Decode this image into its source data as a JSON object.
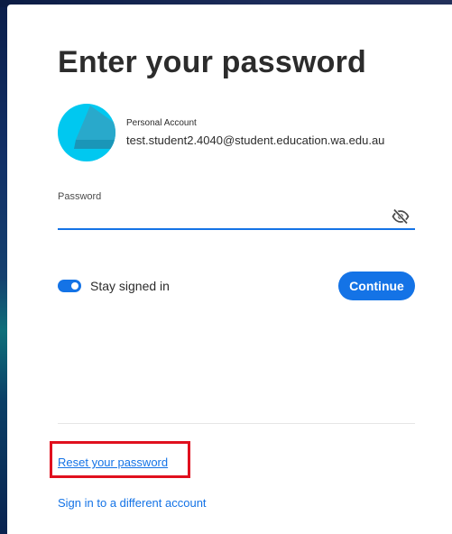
{
  "title": "Enter your password",
  "account": {
    "type": "Personal Account",
    "email": "test.student2.4040@student.education.wa.edu.au",
    "avatar_color": "#00c8f0"
  },
  "password": {
    "label": "Password",
    "value": "",
    "toggle_icon": "eye-slash-icon"
  },
  "stay_signed_in": {
    "label": "Stay signed in",
    "checked": true
  },
  "continue_label": "Continue",
  "links": {
    "reset": "Reset your password",
    "switch_account": "Sign in to a different account"
  },
  "colors": {
    "accent": "#1473e6",
    "highlight": "#e0101e"
  }
}
